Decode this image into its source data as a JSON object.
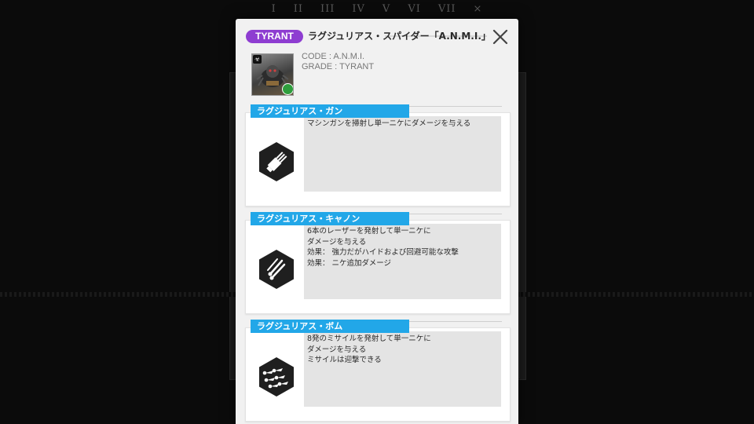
{
  "background": {
    "stage_numerals": [
      "I",
      "II",
      "III",
      "IV",
      "V",
      "VI",
      "VII",
      "⨯"
    ]
  },
  "dialog": {
    "grade_badge": "TYRANT",
    "title": "ラグジュリアス・スパイダー「A.N.M.I.」",
    "close_icon": "close-icon",
    "code_line": "CODE : A.N.M.I.",
    "grade_line": "GRADE : TYRANT",
    "skills": [
      {
        "name": "ラグジュリアス・ガン",
        "icon": "gatling-gun-icon",
        "lines": [
          "マシンガンを掃射し単一ニケにダメージを与える"
        ]
      },
      {
        "name": "ラグジュリアス・キャノン",
        "icon": "laser-beams-icon",
        "lines": [
          "6本のレーザーを発射して単一ニケに",
          "ダメージを与える",
          "効果： 強力だがハイドおよび回避可能な攻撃",
          "効果： ニケ追加ダメージ"
        ]
      },
      {
        "name": "ラグジュリアス・ボム",
        "icon": "missiles-icon",
        "lines": [
          "8発のミサイルを発射して単一ニケに",
          "ダメージを与える",
          "ミサイルは迎撃できる"
        ]
      }
    ]
  },
  "colors": {
    "grade_purple": "#8e3dd1",
    "skill_tab_blue": "#22a7e8",
    "modal_bg": "#f1f1f1"
  }
}
